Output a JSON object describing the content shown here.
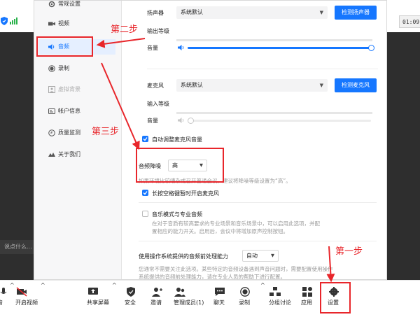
{
  "background": {
    "clock": "01:09",
    "chat_placeholder": "说点什么..."
  },
  "sidebar": {
    "items": [
      {
        "label": "常规设置",
        "icon": "gear-icon"
      },
      {
        "label": "视频",
        "icon": "video-icon"
      },
      {
        "label": "音频",
        "icon": "speaker-icon",
        "active": true
      },
      {
        "label": "录制",
        "icon": "record-icon"
      },
      {
        "label": "虚拟背景",
        "icon": "virtual-background-icon"
      },
      {
        "label": "帐户信息",
        "icon": "account-icon"
      },
      {
        "label": "质量监测",
        "icon": "quality-icon"
      },
      {
        "label": "关于我们",
        "icon": "about-icon"
      }
    ]
  },
  "audio": {
    "speaker": {
      "label": "扬声器",
      "device": "系统默认",
      "test_button": "检测扬声器",
      "output_level_label": "输出等级",
      "volume_label": "音量",
      "volume": 1.0
    },
    "microphone": {
      "label": "麦克风",
      "device": "系统默认",
      "test_button": "检测麦克风",
      "input_level_label": "输入等级",
      "volume_label": "音量",
      "volume": 0.0
    },
    "auto_adjust": {
      "label": "自动调整麦克风音量",
      "checked": true
    },
    "noise": {
      "label": "音频降噪",
      "value": "高",
      "hint": "如果环境比较嘈杂或召开普通会议，建议将降噪等级设置为“高”。"
    },
    "space_unmute": {
      "label": "长按空格键暂时开启麦克风",
      "checked": true
    },
    "music_mode": {
      "label": "音乐模式与专业音频",
      "checked": false,
      "hint_line1": "在对于音质有较高要求的专业场景和音乐场景中，可以启用此选项，并配",
      "hint_line2": "置相应的能力开关。启用后，会议中将增加原声控制按钮。"
    },
    "os_processing": {
      "label": "使用操作系统提供的音频前处理能力",
      "value": "自动",
      "hint_line1": "您通常不需要关注此选项。某些特定的音频设备遇到声音问题时，需要配置使用操作",
      "hint_line2": "系统提供的音频前处理能力，请在专业人员的帮助下进行配置。"
    }
  },
  "toolbar": {
    "items": [
      {
        "label": "音",
        "icon": "microphone-icon"
      },
      {
        "label": "开启视频",
        "icon": "video-off-icon"
      },
      {
        "label": "共享屏幕",
        "icon": "share-screen-icon"
      },
      {
        "label": "安全",
        "icon": "shield-icon"
      },
      {
        "label": "邀请",
        "icon": "invite-icon"
      },
      {
        "label": "管理成员(1)",
        "icon": "members-icon"
      },
      {
        "label": "聊天",
        "icon": "chat-icon"
      },
      {
        "label": "录制",
        "icon": "record-icon"
      },
      {
        "label": "分组讨论",
        "icon": "breakout-icon"
      },
      {
        "label": "应用",
        "icon": "apps-icon"
      },
      {
        "label": "设置",
        "icon": "settings-gear-icon"
      }
    ]
  },
  "annotations": {
    "step1": "第一步",
    "step2": "第二步",
    "step3": "第三步"
  },
  "colors": {
    "accent": "#1677ff",
    "annotation": "#e8262b"
  }
}
